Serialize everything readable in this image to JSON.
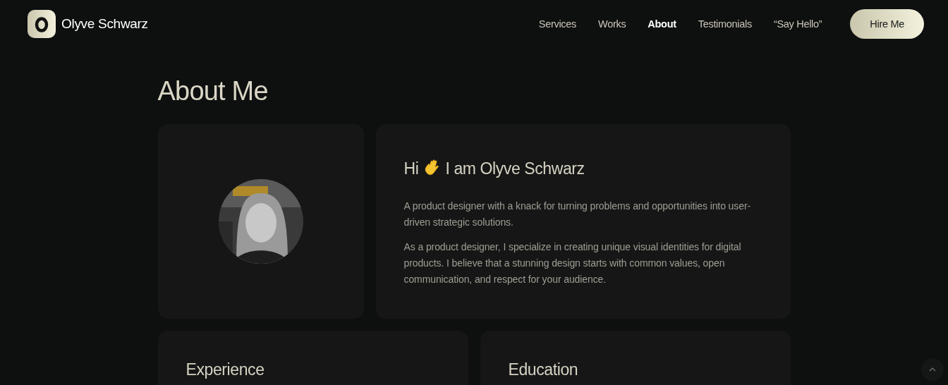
{
  "brand": {
    "name": "Olyve Schwarz"
  },
  "nav": [
    {
      "label": "Services",
      "selected": false
    },
    {
      "label": "Works",
      "selected": false
    },
    {
      "label": "About",
      "selected": true
    },
    {
      "label": "Testimonials",
      "selected": false
    },
    {
      "label": "“Say Hello”",
      "selected": false
    }
  ],
  "cta": "Hire Me",
  "page_title": "About Me",
  "profile": {
    "greeting_start": "Hi",
    "greeting_end": "I am Olyve Schwarz",
    "paragraphs": [
      "A product designer with a knack for turning problems and opportunities into user-driven strategic solutions.",
      "As a product designer, I specialize in creating unique visual identities for digital products. I believe that a stunning design starts with common values, open communication, and respect for your audience."
    ]
  },
  "sections": [
    {
      "title": "Experience"
    },
    {
      "title": "Education"
    }
  ]
}
